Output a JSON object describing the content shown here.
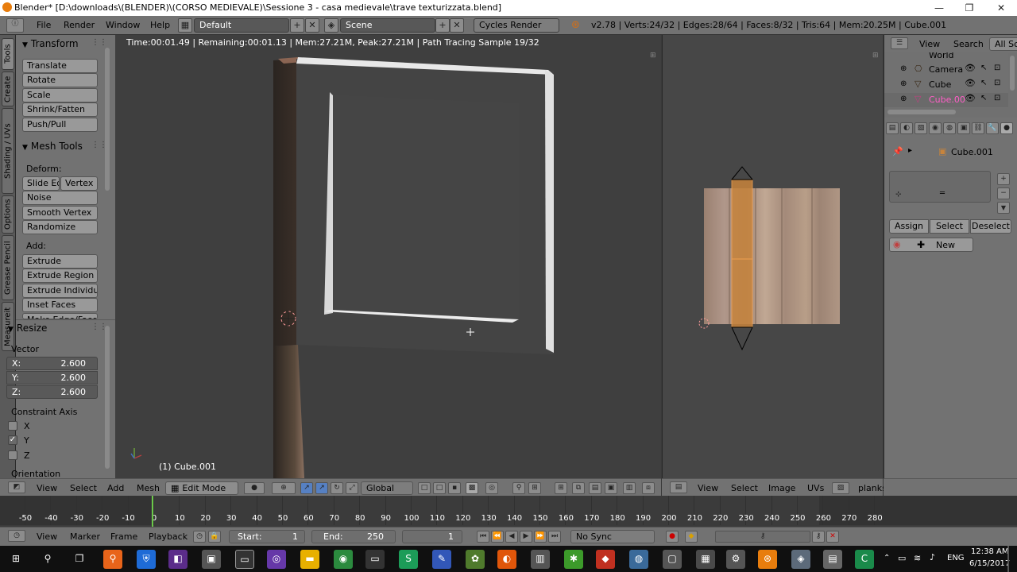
{
  "window": {
    "title": "Blender* [D:\\downloads\\(BLENDER)\\(CORSO MEDIEVALE)\\Sessione 3 - casa medievale\\trave texturizzata.blend]",
    "min": "—",
    "max": "❐",
    "close": "✕"
  },
  "topbar": {
    "menus": [
      "File",
      "Render",
      "Window",
      "Help"
    ],
    "layout": "Default",
    "scene": "Scene",
    "engine": "Cycles Render",
    "stats": "v2.78 | Verts:24/32 | Edges:28/64 | Faces:8/32 | Tris:64 | Mem:20.25M | Cube.001"
  },
  "vtabs": [
    "Tools",
    "Create",
    "Shading / UVs",
    "Options",
    "Grease Pencil",
    "Measureit"
  ],
  "toolshelf": {
    "transform": {
      "title": "Transform",
      "buttons": [
        "Translate",
        "Rotate",
        "Scale",
        "Shrink/Fatten",
        "Push/Pull"
      ]
    },
    "meshtools": {
      "title": "Mesh Tools",
      "deform_label": "Deform:",
      "slide_edge": "Slide Ed",
      "vertex": "Vertex",
      "deform": [
        "Noise",
        "Smooth Vertex",
        "Randomize"
      ],
      "add_label": "Add:",
      "add": [
        "Extrude",
        "Extrude Region",
        "Extrude Individual",
        "Inset Faces",
        "Make Edge/Face"
      ]
    },
    "resize": {
      "title": "Resize",
      "vector_label": "Vector",
      "x_label": "X:",
      "x": "2.600",
      "y_label": "Y:",
      "y": "2.600",
      "z_label": "Z:",
      "z": "2.600",
      "constraint_label": "Constraint Axis",
      "axes": [
        {
          "label": "X",
          "checked": false
        },
        {
          "label": "Y",
          "checked": true
        },
        {
          "label": "Z",
          "checked": false
        }
      ],
      "orientation": "Orientation"
    }
  },
  "viewport": {
    "render_info": "Time:00:01.49 | Remaining:00:01.13 | Mem:27.21M, Peak:27.21M | Path Tracing Sample 19/32",
    "object": "(1) Cube.001",
    "header": {
      "menus": [
        "View",
        "Select",
        "Add",
        "Mesh"
      ],
      "mode": "Edit Mode",
      "orientation": "Global"
    }
  },
  "uv_editor": {
    "header": {
      "menus": [
        "View",
        "Select",
        "Image",
        "UVs"
      ],
      "image": "planks"
    }
  },
  "outliner": {
    "header": {
      "view": "View",
      "search": "Search",
      "all": "All Sce"
    },
    "items": [
      "World",
      "Camera",
      "Cube",
      "Cube.00"
    ]
  },
  "properties": {
    "object": "Cube.001",
    "buttons": [
      "Assign",
      "Select",
      "Deselect"
    ],
    "new": "New"
  },
  "timeline": {
    "ticks": [
      "-50",
      "-40",
      "-30",
      "-20",
      "-10",
      "0",
      "10",
      "20",
      "30",
      "40",
      "50",
      "60",
      "70",
      "80",
      "90",
      "100",
      "110",
      "120",
      "130",
      "140",
      "150",
      "160",
      "170",
      "180",
      "190",
      "200",
      "210",
      "220",
      "230",
      "240",
      "250",
      "260",
      "270",
      "280"
    ],
    "header": {
      "menus": [
        "View",
        "Marker",
        "Frame",
        "Playback"
      ],
      "start_label": "Start:",
      "start": "1",
      "end_label": "End:",
      "end": "250",
      "current": "1",
      "sync": "No Sync"
    }
  },
  "taskbar": {
    "time": "12:38 AM",
    "date": "6/15/2017",
    "lang": "ENG"
  }
}
